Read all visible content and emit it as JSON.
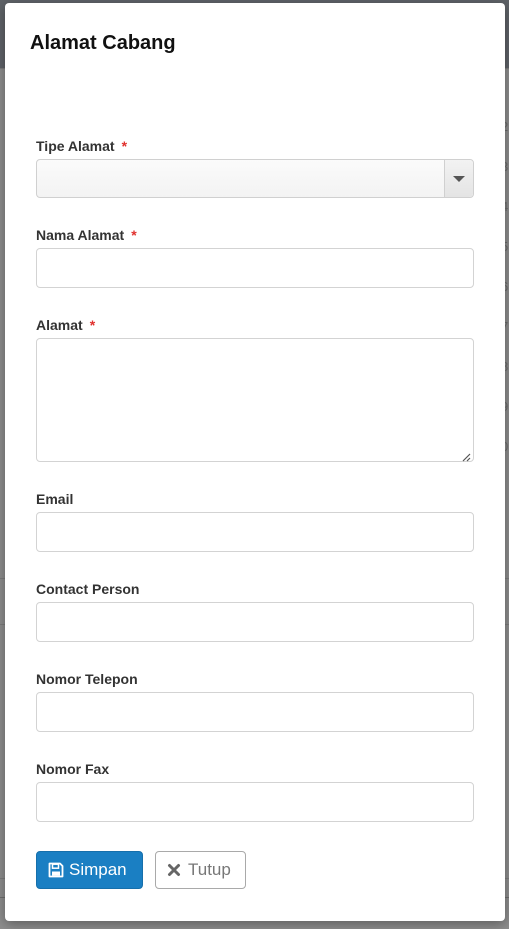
{
  "modal": {
    "title": "Alamat Cabang",
    "required_mark": "*"
  },
  "fields": {
    "tipe_alamat": {
      "label": "Tipe Alamat",
      "value": "",
      "required": true
    },
    "nama_alamat": {
      "label": "Nama Alamat",
      "value": "",
      "placeholder": "",
      "required": true
    },
    "alamat": {
      "label": "Alamat",
      "value": "",
      "placeholder": "",
      "required": true
    },
    "email": {
      "label": "Email",
      "value": "",
      "placeholder": ""
    },
    "contact_person": {
      "label": "Contact Person",
      "value": "",
      "placeholder": ""
    },
    "nomor_telepon": {
      "label": "Nomor Telepon",
      "value": "",
      "placeholder": ""
    },
    "nomor_fax": {
      "label": "Nomor Fax",
      "value": "",
      "placeholder": ""
    }
  },
  "buttons": {
    "save": {
      "label": "Simpan",
      "icon": "floppy-disk-icon"
    },
    "close": {
      "label": "Tutup",
      "icon": "close-x-icon"
    }
  },
  "background": {
    "row_digits": [
      "2",
      "3",
      "4",
      "5",
      "6",
      "7",
      "8",
      "9",
      "0",
      "("
    ]
  },
  "colors": {
    "primary_button": "#1a7fc3",
    "required_star": "#e0302d",
    "overlay": "#8e8e8e"
  }
}
